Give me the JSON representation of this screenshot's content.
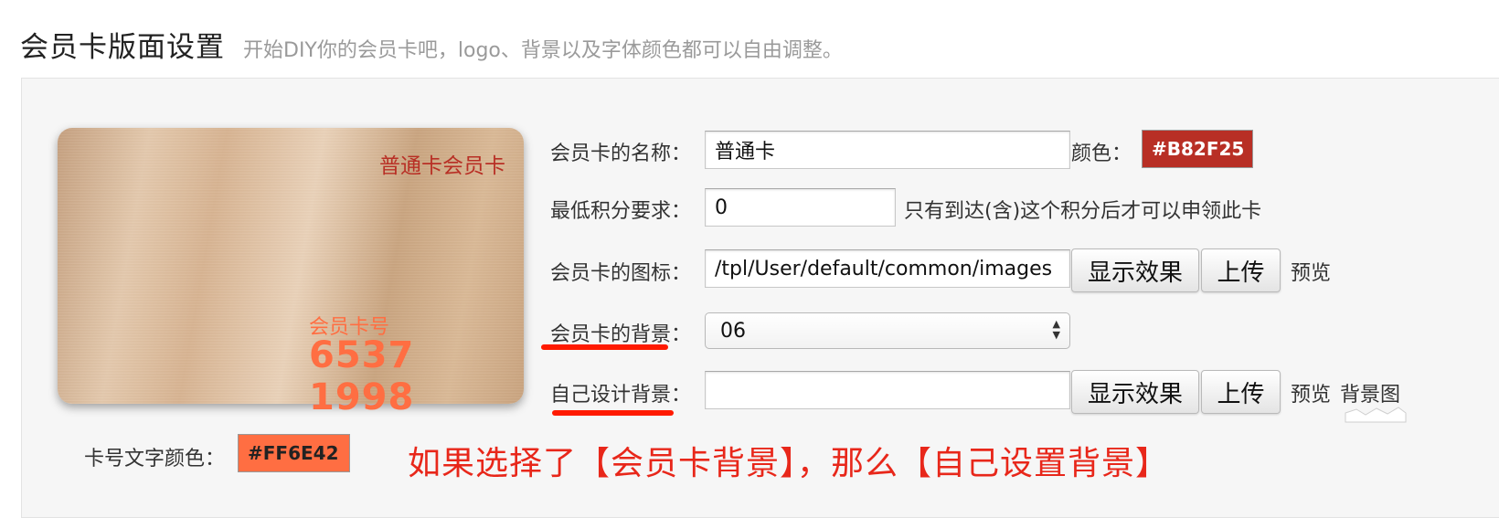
{
  "header": {
    "title": "会员卡版面设置",
    "subtitle": "开始DIY你的会员卡吧，logo、背景以及字体颜色都可以自由调整。"
  },
  "card_preview": {
    "name": "普通卡会员卡",
    "number_label": "会员卡号",
    "number": "6537 1998"
  },
  "form": {
    "name_label": "会员卡的名称：",
    "name_value": "普通卡",
    "color_label": "颜色：",
    "name_color": "#B82F25",
    "min_points_label": "最低积分要求：",
    "min_points_value": "0",
    "min_points_hint": "只有到达(含)这个积分后才可以申领此卡",
    "icon_label": "会员卡的图标：",
    "icon_value": "/tpl/User/default/common/images",
    "show_effect_label": "显示效果",
    "upload_label": "上传",
    "preview_label": "预览",
    "background_label": "会员卡的背景：",
    "background_value": "06",
    "custom_bg_label": "自己设计背景：",
    "custom_bg_value": "",
    "bg_image_label": "背景图",
    "number_color_label": "卡号文字颜色：",
    "number_color": "#FF6E42"
  },
  "annotation": {
    "note": "如果选择了【会员卡背景】，那么【自己设置背景】",
    "underline_color": "#FF1A00"
  }
}
